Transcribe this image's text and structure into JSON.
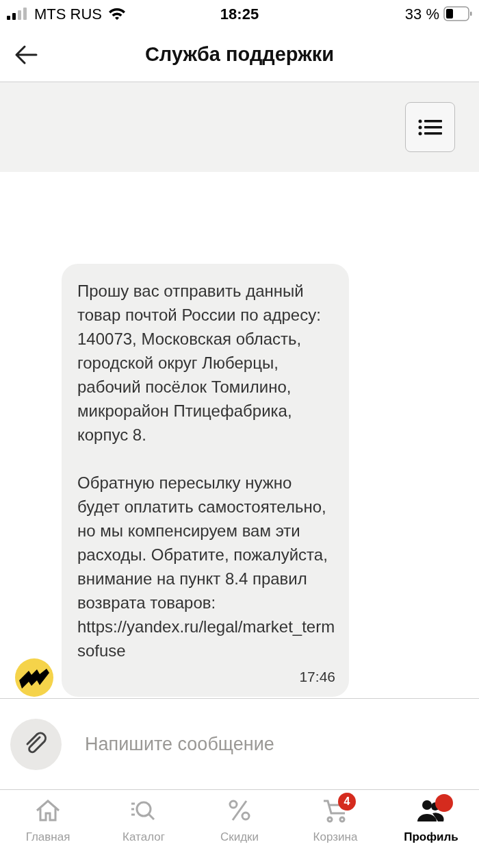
{
  "status_bar": {
    "carrier": "MTS RUS",
    "time": "18:25",
    "battery": "33 %"
  },
  "header": {
    "title": "Служба поддержки"
  },
  "messages": [
    {
      "paragraphs": [
        "Прошу вас отправить данный товар почтой России по адресу: 140073, Московская область, городской округ Люберцы, рабочий посёлок Томилино, микрорайон Птицефабрика, корпус 8.",
        "Обратную пересылку нужно будет оплатить самостоятельно, но мы компенсируем вам эти расходы. Обратите, пожалуйста, внимание на пункт 8.4 правил возврата товаров: https://yandex.ru/legal/market_termsofuse"
      ],
      "time": "17:46"
    }
  ],
  "composer": {
    "placeholder": "Напишите сообщение"
  },
  "tab_bar": [
    {
      "kind": "home",
      "label": "Главная",
      "selected": false
    },
    {
      "kind": "catalog",
      "label": "Каталог",
      "selected": false
    },
    {
      "kind": "discounts",
      "label": "Скидки",
      "selected": false
    },
    {
      "kind": "cart",
      "label": "Корзина",
      "selected": false,
      "badge": "4"
    },
    {
      "kind": "profile",
      "label": "Профиль",
      "selected": true,
      "notification_dot": true
    }
  ]
}
